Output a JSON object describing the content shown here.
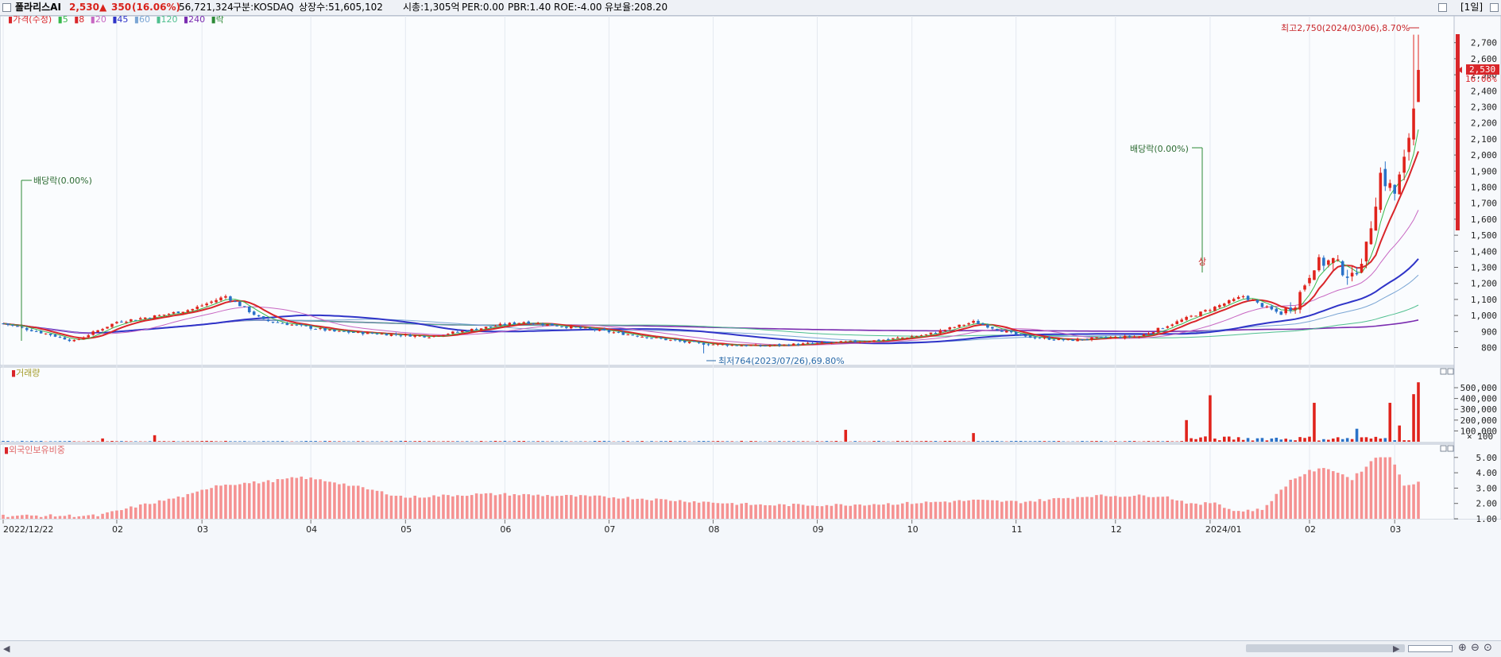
{
  "header": {
    "stock_name": "폴라리스AI",
    "price": "2,530",
    "change_arrow": "▲",
    "change": "350",
    "change_pct": "(16.06%)",
    "volume": "56,721,324",
    "market": "구분:KOSDAQ",
    "listed_shares": "상장수:51,605,102",
    "market_cap": "시총:1,305억",
    "per": "PER:0.00",
    "pbr": "PBR:1.40",
    "roe": "ROE:-4.00",
    "retention": "유보율:208.20",
    "period": "[1일]"
  },
  "colors": {
    "up": "#e0231c",
    "down": "#2a72c8",
    "ma5": "#37b94b",
    "ma8": "#d9262a",
    "ma20": "#c766c2",
    "ma45": "#2f34c8",
    "ma60": "#7aa5d4",
    "ma120": "#4fbf8f",
    "ma240": "#7a2cb0",
    "foreign": "#f59292"
  },
  "chart_data": [
    {
      "type": "candlestick",
      "panel": "가격(수정)",
      "legend": [
        "가격(수정)",
        "5",
        "8",
        "20",
        "45",
        "60",
        "120",
        "240",
        "락"
      ],
      "ylim": [
        764,
        2750
      ],
      "yticks": [
        "2,700",
        "2,600",
        "2,500",
        "2,400",
        "2,300",
        "2,200",
        "2,100",
        "2,000",
        "1,900",
        "1,800",
        "1,700",
        "1,600",
        "1,500",
        "1,400",
        "1,300",
        "1,200",
        "1,100",
        "1,000",
        "900",
        "800"
      ],
      "x_labels": [
        "2022/12/22",
        "02",
        "03",
        "04",
        "05",
        "06",
        "07",
        "08",
        "09",
        "10",
        "11",
        "12",
        "2024/01",
        "02",
        "03"
      ],
      "last_price_label": "2,530",
      "last_change_label": "16.06%",
      "annotations": {
        "high": "최고2,750(2024/03/06),8.70%",
        "low": "최저764(2023/07/26),69.80%",
        "dividend": "배당락(0.00%)",
        "dividend_marker": "상"
      },
      "key_points": [
        {
          "date": "2022/12/22",
          "close": 950
        },
        {
          "date": "2023/03/06",
          "close": 1150
        },
        {
          "date": "2023/07/26",
          "low": 764
        },
        {
          "date": "2024/01/02",
          "close": 1230
        },
        {
          "date": "2024/03/06",
          "high": 2750
        },
        {
          "date": "2024/03/07",
          "close": 2530
        }
      ]
    },
    {
      "type": "bar",
      "panel": "거래량",
      "yticks": [
        "500,000",
        "400,000",
        "300,000",
        "200,000",
        "100,000"
      ],
      "unit": "× 100",
      "spikes": [
        {
          "date": "2023/09/15",
          "value": 110000
        },
        {
          "date": "2023/10/17",
          "value": 80000
        },
        {
          "date": "2024/01/02",
          "value": 430000
        },
        {
          "date": "2024/02/01",
          "value": 360000
        },
        {
          "date": "2024/02/26",
          "value": 360000
        },
        {
          "date": "2024/03/06",
          "value": 440000
        },
        {
          "date": "2024/03/07",
          "value": 550000
        }
      ]
    },
    {
      "type": "bar",
      "panel": "외국인보유비중",
      "yticks": [
        "5.00",
        "4.00",
        "3.00",
        "2.00",
        "1.00"
      ],
      "ylim": [
        1.0,
        5.3
      ],
      "key_points": [
        {
          "date": "2023/01",
          "value": 1.2
        },
        {
          "date": "2023/03/20",
          "value": 3.7
        },
        {
          "date": "2023/05",
          "value": 2.4
        },
        {
          "date": "2023/12",
          "value": 2.5
        },
        {
          "date": "2024/01/20",
          "value": 1.5
        },
        {
          "date": "2024/02/05",
          "value": 4.3
        },
        {
          "date": "2024/02/28",
          "value": 5.1
        },
        {
          "date": "2024/03/07",
          "value": 3.4
        }
      ]
    }
  ],
  "volume_panel": {
    "title": "거래량"
  },
  "foreign_panel": {
    "title": "외국인보유비중"
  }
}
